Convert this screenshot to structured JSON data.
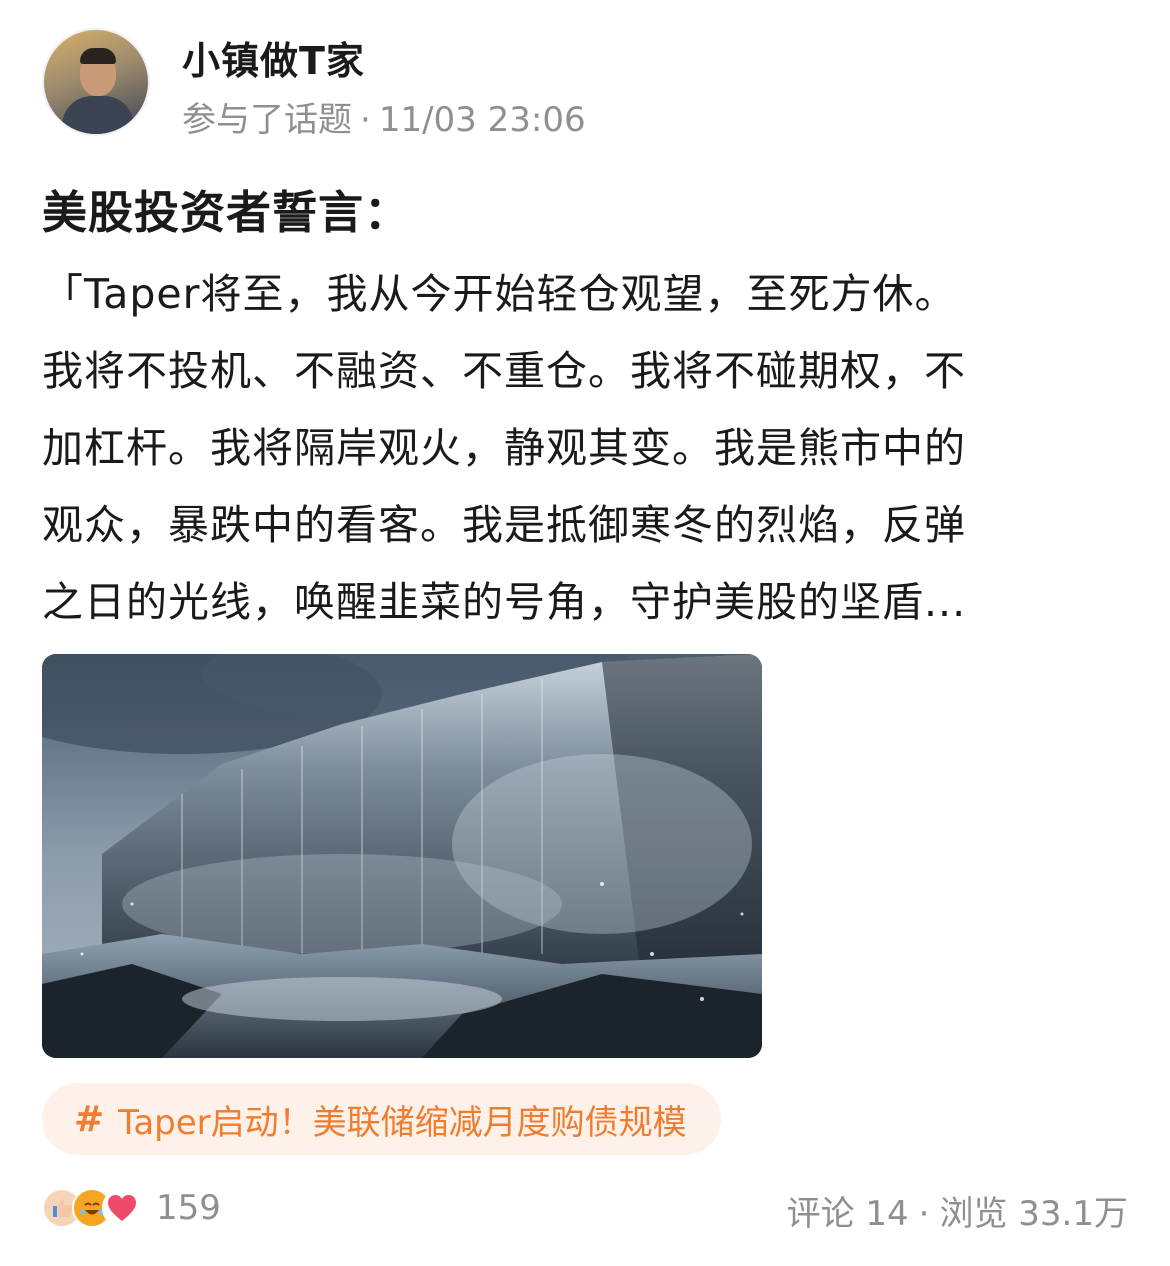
{
  "author": {
    "name": "小镇做T家",
    "activity": "参与了话题",
    "timestamp": "11/03 23:06"
  },
  "post": {
    "title": "美股投资者誓言：",
    "lines": [
      "「Taper将至，我从今开始轻仓观望，至死方休。",
      "我将不投机、不融资、不重仓。我将不碰期权，不",
      "加杠杆。我将隔岸观火，静观其变。我是熊市中的",
      "观众，暴跌中的看客。我是抵御寒冬的烈焰，反弹",
      "之日的光线，唤醒韭菜的号角，守护美股的坚盾..."
    ]
  },
  "topic": {
    "hash": "#",
    "label": "Taper启动！美联储缩减月度购债规模"
  },
  "footer": {
    "reaction_count": "159",
    "comments_label": "评论",
    "comments_count": "14",
    "views_label": "浏览",
    "views_count": "33.1万",
    "separator": "·"
  },
  "icons": {
    "like": "thumbs-up-icon",
    "laugh": "laughing-face-icon",
    "heart": "heart-icon"
  },
  "colors": {
    "topic_accent": "#f07d2f",
    "topic_background": "#fdf1e9",
    "meta_gray": "#8f8f8f",
    "text": "#1a1a1a"
  }
}
